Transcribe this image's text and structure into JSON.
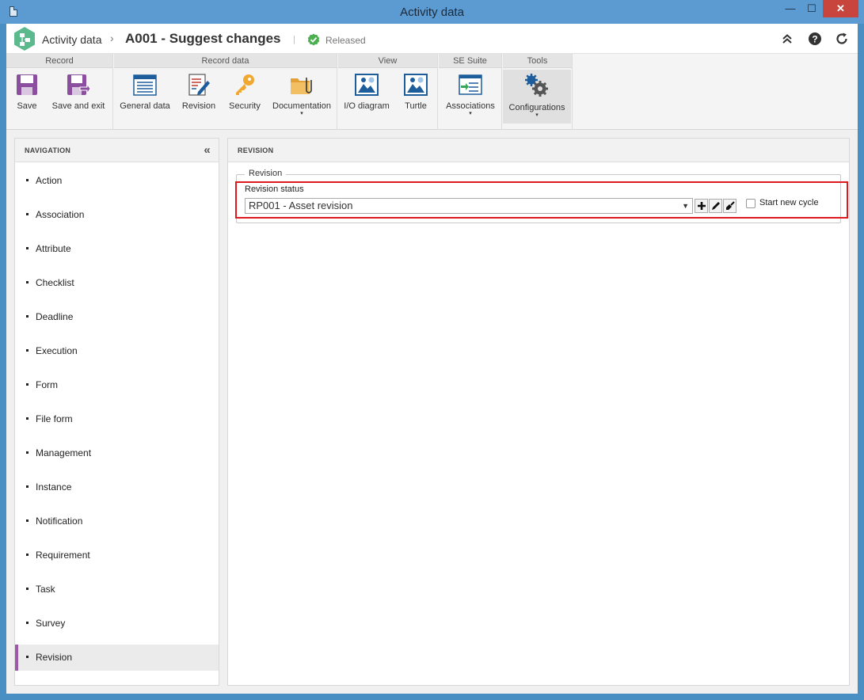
{
  "window": {
    "title": "Activity data",
    "min_glyph": "—",
    "max_glyph": "☐",
    "close_glyph": "✕"
  },
  "header": {
    "app_name": "Activity data",
    "separator": "›",
    "record_title": "A001 - Suggest changes",
    "divider": "|",
    "status": "Released",
    "status_color": "#4caf50"
  },
  "ribbon": {
    "groups": [
      {
        "label": "Record",
        "buttons": [
          "Save",
          "Save and exit"
        ]
      },
      {
        "label": "Record data",
        "buttons": [
          "General data",
          "Revision",
          "Security",
          "Documentation"
        ]
      },
      {
        "label": "View",
        "buttons": [
          "I/O diagram",
          "Turtle"
        ]
      },
      {
        "label": "SE Suite",
        "buttons": [
          "Associations"
        ]
      },
      {
        "label": "Tools",
        "buttons": [
          "Configurations"
        ]
      }
    ],
    "dropdown_caret": "▾"
  },
  "navigation": {
    "header": "NAVIGATION",
    "collapse_glyph": "«",
    "items": [
      "Action",
      "Association",
      "Attribute",
      "Checklist",
      "Deadline",
      "Execution",
      "Form",
      "File form",
      "Management",
      "Instance",
      "Notification",
      "Requirement",
      "Task",
      "Survey",
      "Revision"
    ],
    "selected": "Revision",
    "accent": "#9a5aa8"
  },
  "main": {
    "header": "REVISION",
    "fieldset_legend": "Revision",
    "status_label": "Revision status",
    "status_value": "RP001 - Asset revision",
    "select_arrow": "▼",
    "checkbox_label": "Start new cycle",
    "checkbox_checked": false,
    "highlight_color": "#e0191f"
  }
}
